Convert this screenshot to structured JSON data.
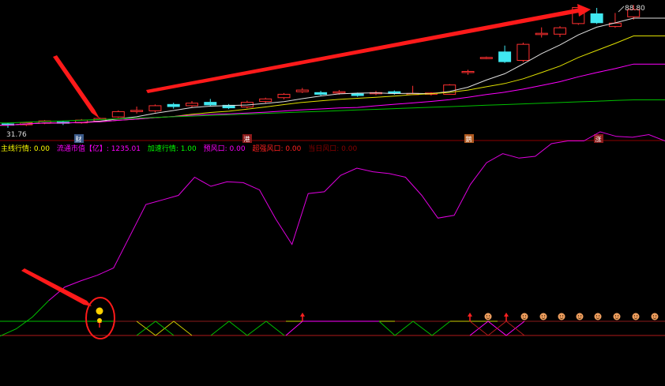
{
  "chart_data": [
    {
      "type": "candlestick",
      "price_labels": {
        "high": "88.80",
        "low": "31.76"
      },
      "markers": [
        "财",
        "港",
        "鹅",
        "涨"
      ],
      "candles": [
        {
          "o": 34.0,
          "c": 33.4,
          "h": 34.6,
          "l": 32.2
        },
        {
          "o": 33.6,
          "c": 34.6,
          "h": 35.0,
          "l": 33.0
        },
        {
          "o": 34.3,
          "c": 35.4,
          "h": 35.8,
          "l": 33.9
        },
        {
          "o": 34.9,
          "c": 34.3,
          "h": 35.5,
          "l": 33.5
        },
        {
          "o": 34.5,
          "c": 35.8,
          "h": 36.3,
          "l": 34.1
        },
        {
          "o": 35.3,
          "c": 36.6,
          "h": 37.0,
          "l": 34.8
        },
        {
          "o": 37.3,
          "c": 39.8,
          "h": 40.4,
          "l": 36.8
        },
        {
          "o": 40.0,
          "c": 40.4,
          "h": 42.2,
          "l": 38.9
        },
        {
          "o": 40.2,
          "c": 42.6,
          "h": 43.2,
          "l": 39.4
        },
        {
          "o": 43.2,
          "c": 42.2,
          "h": 44.0,
          "l": 41.2
        },
        {
          "o": 42.6,
          "c": 43.8,
          "h": 44.8,
          "l": 41.8
        },
        {
          "o": 44.2,
          "c": 43.0,
          "h": 45.8,
          "l": 42.4
        },
        {
          "o": 42.8,
          "c": 41.6,
          "h": 43.4,
          "l": 41.0
        },
        {
          "o": 42.0,
          "c": 44.2,
          "h": 45.0,
          "l": 41.4
        },
        {
          "o": 44.6,
          "c": 45.8,
          "h": 46.4,
          "l": 43.8
        },
        {
          "o": 46.4,
          "c": 48.0,
          "h": 48.6,
          "l": 45.6
        },
        {
          "o": 49.2,
          "c": 50.0,
          "h": 51.0,
          "l": 48.6
        },
        {
          "o": 48.8,
          "c": 48.0,
          "h": 49.6,
          "l": 47.4
        },
        {
          "o": 48.6,
          "c": 49.2,
          "h": 50.0,
          "l": 47.8
        },
        {
          "o": 48.2,
          "c": 47.4,
          "h": 48.8,
          "l": 46.8
        },
        {
          "o": 48.4,
          "c": 48.8,
          "h": 49.6,
          "l": 47.6
        },
        {
          "o": 49.2,
          "c": 48.4,
          "h": 49.8,
          "l": 47.8
        },
        {
          "o": 48.0,
          "c": 48.4,
          "h": 52.0,
          "l": 47.6
        },
        {
          "o": 48.0,
          "c": 48.6,
          "h": 49.0,
          "l": 47.4
        },
        {
          "o": 48.0,
          "c": 52.4,
          "h": 52.8,
          "l": 47.8
        },
        {
          "o": 58.4,
          "c": 58.8,
          "h": 59.6,
          "l": 57.2
        },
        {
          "o": 65.2,
          "c": 65.4,
          "h": 65.8,
          "l": 64.6
        },
        {
          "o": 68.0,
          "c": 63.4,
          "h": 71.0,
          "l": 62.8
        },
        {
          "o": 64.0,
          "c": 71.6,
          "h": 72.4,
          "l": 63.2
        },
        {
          "o": 76.2,
          "c": 76.8,
          "h": 79.6,
          "l": 74.8
        },
        {
          "o": 76.4,
          "c": 79.4,
          "h": 80.2,
          "l": 75.0
        },
        {
          "o": 81.4,
          "c": 89.0,
          "h": 89.6,
          "l": 80.8
        },
        {
          "o": 86.0,
          "c": 81.8,
          "h": 88.8,
          "l": 81.2
        },
        {
          "o": 80.0,
          "c": 81.6,
          "h": 86.4,
          "l": 79.4
        },
        {
          "o": 84.6,
          "c": 88.0,
          "h": 90.2,
          "l": 83.2
        }
      ]
    },
    {
      "type": "line",
      "legend": [
        {
          "text": "主线行情: 0.00",
          "color": "#ffff00"
        },
        {
          "text": "流通市值【亿】: 1235.01",
          "color": "#ff00ff"
        },
        {
          "text": "加速行情: 1.00",
          "color": "#00ff00"
        },
        {
          "text": "预风口: 0.00",
          "color": "#ff00ff"
        },
        {
          "text": "超强风口: 0.00",
          "color": "#ff2020"
        },
        {
          "text": "当日风口: 0.00",
          "color": "#8b0000"
        }
      ],
      "series_values": [
        -0.5,
        0.3,
        1.6,
        3.4,
        4.9,
        5.6,
        6.2,
        7.0,
        10.5,
        14.0,
        14.5,
        15.0,
        17.0,
        16.0,
        16.5,
        16.4,
        15.6,
        12.4,
        9.6,
        15.2,
        15.4,
        17.2,
        18.0,
        17.6,
        17.4,
        17.0,
        15.0,
        12.5,
        12.8,
        16.2,
        18.6,
        19.6,
        19.1,
        19.3,
        20.7,
        21.0,
        21.0,
        22.0,
        21.5,
        21.4,
        21.7,
        21.0
      ]
    }
  ]
}
